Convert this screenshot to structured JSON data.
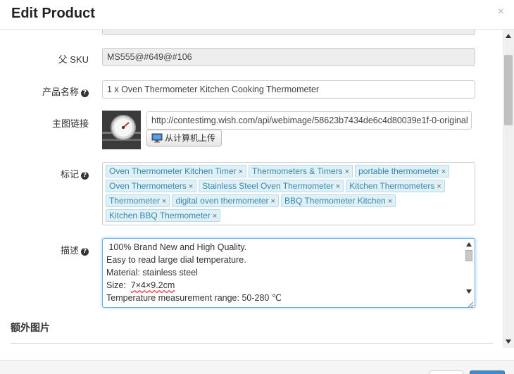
{
  "modal": {
    "title": "Edit Product",
    "close_glyph": "×"
  },
  "form": {
    "parent_sku": {
      "label": "父 SKU",
      "value": "MS555@#649@#106"
    },
    "product_name": {
      "label": "产品名称",
      "value": "1 x  Oven Thermometer Kitchen Cooking Thermometer"
    },
    "main_image": {
      "label": "主图链接",
      "url": "http://contestimg.wish.com/api/webimage/58623b7434de6c4d80039e1f-0-original",
      "upload_label": "从计算机上传"
    },
    "tags": {
      "label": "标记",
      "items": [
        "Oven Thermometer Kitchen Timer",
        "Thermometers & Timers",
        "portable thermometer",
        "Oven Thermometers",
        "Stainless Steel Oven Thermometer",
        "Kitchen Thermometers",
        "Thermometer",
        "digital oven thermometer",
        "BBQ Thermometer Kitchen",
        "Kitchen BBQ Thermometer"
      ],
      "remove_glyph": "×"
    },
    "description": {
      "label": "描述",
      "lines": [
        " 100% Brand New and High Quality.",
        "Easy to read large dial temperature.",
        "Material: stainless steel",
        "Temperature measurement range: 50-280 ℃"
      ],
      "size_prefix": "Size:  ",
      "size_value": "7×4×9.2cm"
    },
    "extra_images": {
      "title": "额外图片"
    }
  },
  "icons": {
    "help": "question-circle-icon",
    "upload": "monitor-icon",
    "close": "close-icon"
  },
  "colors": {
    "tag_bg": "#dff0f7",
    "tag_text": "#3a87ad",
    "focus_border": "#66afe9"
  }
}
